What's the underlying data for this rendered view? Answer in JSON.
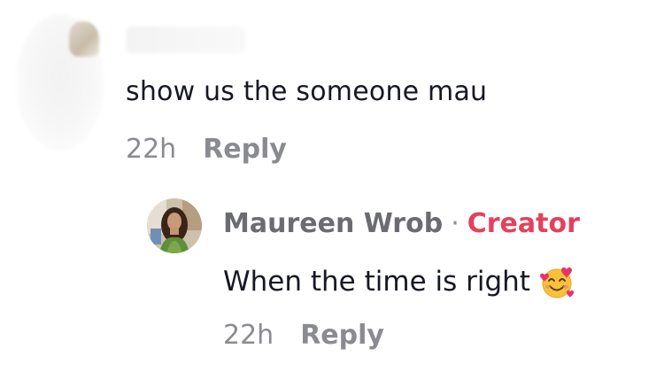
{
  "parent_comment": {
    "text": "show us the someone mau",
    "time": "22h",
    "reply_label": "Reply"
  },
  "reply_comment": {
    "username": "Maureen Wrob",
    "separator": "·",
    "badge": "Creator",
    "text": "When the time is right",
    "emoji_icon": "smiling-face-with-hearts-icon",
    "time": "22h",
    "reply_label": "Reply"
  },
  "colors": {
    "primary_text": "#161823",
    "secondary_text": "#8a8b91",
    "username_text": "#6b6c72",
    "creator_badge": "#e3415c"
  }
}
